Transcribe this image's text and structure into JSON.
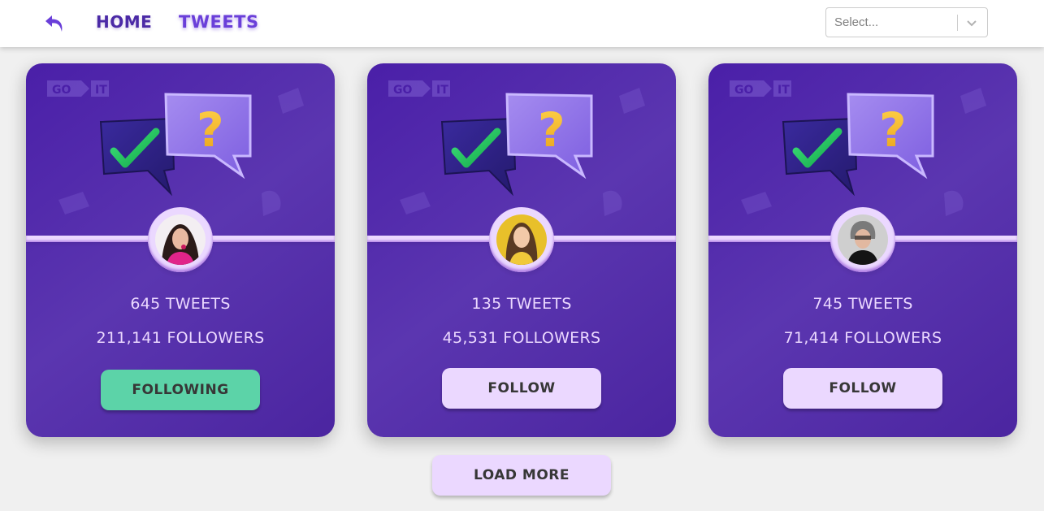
{
  "nav": {
    "home_label": "HOME",
    "tweets_label": "TWEETS",
    "back_icon": "back-arrow-icon"
  },
  "filter": {
    "placeholder": "Select..."
  },
  "cards": [
    {
      "logo_left": "GO",
      "logo_right": "IT",
      "tweets": "645 TWEETS",
      "followers": "211,141 FOLLOWERS",
      "button_label": "FOLLOWING",
      "is_following": true
    },
    {
      "logo_left": "GO",
      "logo_right": "IT",
      "tweets": "135 TWEETS",
      "followers": "45,531 FOLLOWERS",
      "button_label": "FOLLOW",
      "is_following": false
    },
    {
      "logo_left": "GO",
      "logo_right": "IT",
      "tweets": "745 TWEETS",
      "followers": "71,414 FOLLOWERS",
      "button_label": "FOLLOW",
      "is_following": false
    }
  ],
  "load_more_label": "LOAD MORE",
  "colors": {
    "accent": "#5736a3",
    "card_light": "#ebd8ff",
    "following": "#5cd3a8",
    "nav_home": "#4b2aa6",
    "nav_tweets": "#6a3fd9"
  }
}
